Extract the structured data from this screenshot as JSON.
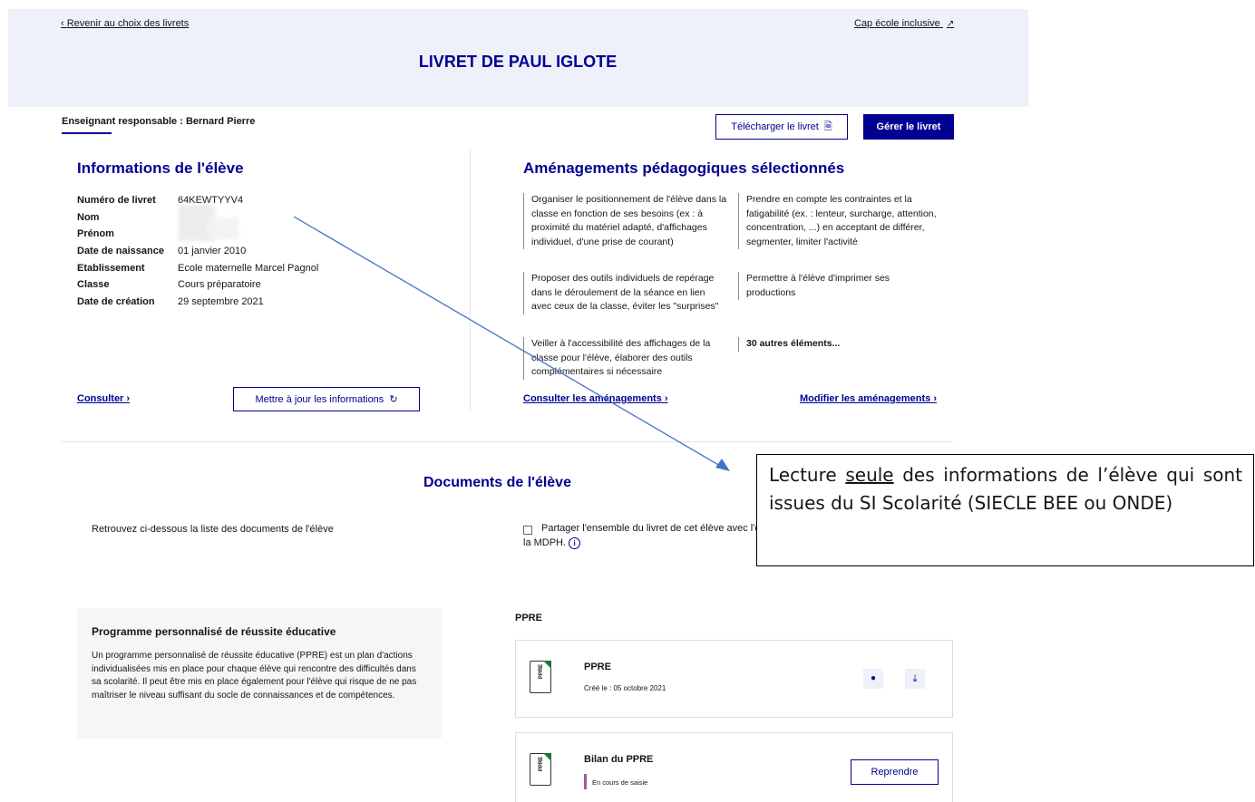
{
  "header": {
    "back_link": "Revenir au choix des livrets",
    "external_link": "Cap école inclusive",
    "title": "LIVRET DE PAUL IGLOTE"
  },
  "teacher": {
    "label": "Enseignant responsable :",
    "name": "Bernard Pierre"
  },
  "actions": {
    "download": "Télécharger le livret",
    "manage": "Gérer le livret"
  },
  "student_info": {
    "title": "Informations de l'élève",
    "fields": [
      {
        "label": "Numéro de livret",
        "value": "64KEWTYYV4"
      },
      {
        "label": "Nom",
        "value": ""
      },
      {
        "label": "Prénom",
        "value": ""
      },
      {
        "label": "Date de naissance",
        "value": "01 janvier 2010"
      },
      {
        "label": "Etablissement",
        "value": "Ecole maternelle Marcel Pagnol"
      },
      {
        "label": "Classe",
        "value": "Cours préparatoire"
      },
      {
        "label": "Date de création",
        "value": "29 septembre 2021"
      }
    ],
    "consult_link": "Consulter",
    "update_button": "Mettre à jour les informations"
  },
  "adjustments": {
    "title": "Aménagements pédagogiques sélectionnés",
    "items": [
      "Organiser le positionnement de l'élève dans la classe en fonction de ses besoins (ex : à proximité du matériel adapté, d'affichages individuel, d'une prise de courant)",
      "Prendre en compte les contraintes et la fatigabilité (ex. : lenteur, surcharge, attention, concentration, ...) en acceptant de différer, segmenter, limiter l'activité",
      "Proposer des outils individuels de repérage dans le déroulement de la séance en lien avec ceux de la classe, éviter les \"surprises\"",
      "Permettre à l'élève d'imprimer ses productions",
      "Veiller à l'accessibilité des affichages de la classe pour l'élève, élaborer des outils complémentaires si nécessaire"
    ],
    "more": "30 autres éléments...",
    "consult_link": "Consulter les aménagements",
    "modify_link": "Modifier les aménagements"
  },
  "documents": {
    "title": "Documents de l'élève",
    "intro": "Retrouvez ci-dessous la liste des documents de l'élève",
    "share_line1": "Partager l'ensemble du livret de cet élève avec l'é",
    "share_line2": "la MDPH.",
    "ppre_box": {
      "title": "Programme personnalisé de réussite éducative",
      "text": "Un programme personnalisé de réussite éducative (PPRE) est un plan d'actions individualisées mis en place pour chaque élève qui rencontre des difficultés dans sa scolarité. Il peut être mis en place également pour l'élève qui risque de ne pas maîtriser le niveau suffisant du socle de connaissances et de compétences."
    },
    "section_label": "PPRE",
    "cards": [
      {
        "icon_label": "PPRE",
        "title": "PPRE",
        "meta": "Créé le : 05 octobre 2021"
      },
      {
        "icon_label": "PPRE",
        "title": "Bilan du PPRE",
        "status": "En cours de saisie",
        "button": "Reprendre"
      }
    ]
  },
  "callout": {
    "before": "Lecture ",
    "underlined": "seule",
    "after": " des informations de l’élève qui sont issues du SI Scolarité (SIECLE BEE ou ONDE)"
  },
  "colors": {
    "primary": "#000091",
    "header_bg": "#eef0fa",
    "status_bar": "#a558a0",
    "file_corner": "#18753c"
  }
}
